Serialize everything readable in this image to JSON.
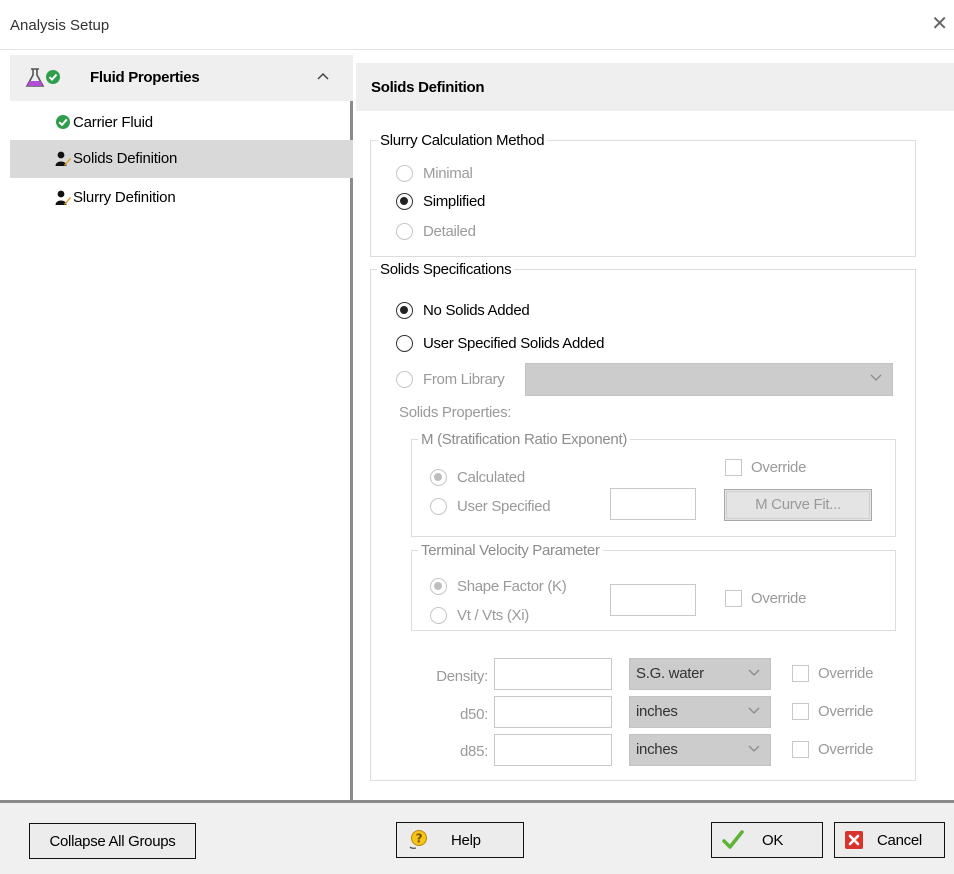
{
  "window": {
    "title": "Analysis Setup"
  },
  "sidebar": {
    "group_label": "Fluid Properties",
    "items": [
      {
        "label": "Carrier Fluid"
      },
      {
        "label": "Solids Definition"
      },
      {
        "label": "Slurry Definition"
      }
    ]
  },
  "panel": {
    "title": "Solids Definition",
    "slurry_method": {
      "legend": "Slurry Calculation Method",
      "options": [
        "Minimal",
        "Simplified",
        "Detailed"
      ],
      "selected": "Simplified"
    },
    "solids_specs": {
      "legend": "Solids Specifications",
      "options": [
        "No Solids Added",
        "User Specified Solids Added",
        "From Library"
      ],
      "selected": "No Solids Added",
      "library_value": "",
      "properties_label": "Solids Properties:",
      "m_group": {
        "legend": "M (Stratification Ratio Exponent)",
        "options": [
          "Calculated",
          "User Specified"
        ],
        "selected": "Calculated",
        "override_label": "Override",
        "curve_fit_label": "M Curve Fit..."
      },
      "tvp_group": {
        "legend": "Terminal Velocity Parameter",
        "options": [
          "Shape Factor (K)",
          "Vt / Vts (Xi)"
        ],
        "selected": "Shape Factor (K)",
        "override_label": "Override"
      },
      "fields": [
        {
          "label": "Density:",
          "unit": "S.G. water",
          "override": "Override"
        },
        {
          "label": "d50:",
          "unit": "inches",
          "override": "Override"
        },
        {
          "label": "d85:",
          "unit": "inches",
          "override": "Override"
        }
      ]
    }
  },
  "footer": {
    "collapse_label": "Collapse All Groups",
    "help_label": "Help",
    "ok_label": "OK",
    "cancel_label": "Cancel"
  },
  "colors": {
    "check_green": "#2e9e4b",
    "flask_purple": "#b04fd6",
    "cancel_red": "#d9342b"
  }
}
